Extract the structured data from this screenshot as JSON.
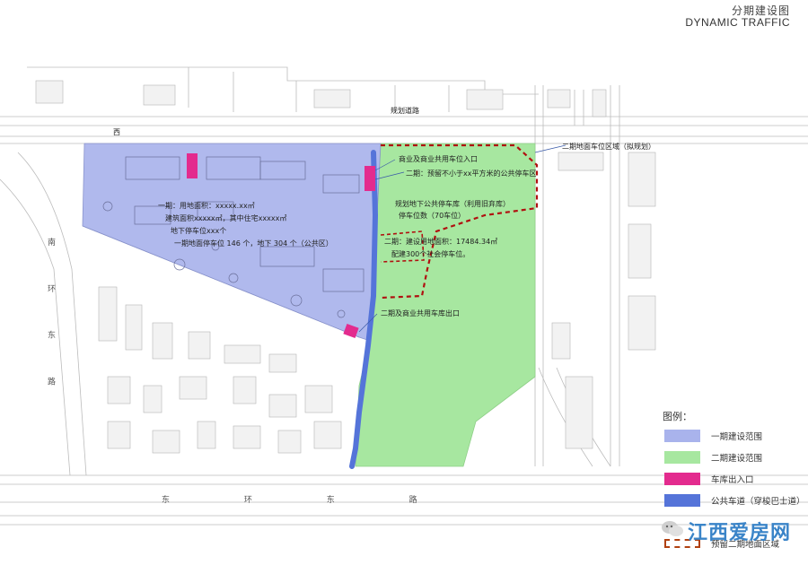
{
  "header": {
    "title_cn": "分期建设图",
    "title_en": "DYNAMIC TRAFFIC"
  },
  "annotations": {
    "phase1_entrance": "商业及商业共用车位入口",
    "phase2_entrance_top": "二期地面车位区域（拟规划）",
    "phase2_area_note": "二期：预留不小于xx平方米的公共停车区",
    "public_parking": "规划地下公共停车库（利用旧弃库）",
    "public_parking_count": "停车位数（70车位）",
    "phase2_building": "二期：建设用地面积：17484.34㎡",
    "phase2_building_2": "配建300个社会停车位。",
    "phase1_exit": "二期及商业共用车库出口",
    "phase1_detail_1": "一期：用地面积：xxxxx.xx㎡",
    "phase1_detail_2": "建筑面积xxxxx㎡，其中住宅xxxxx㎡",
    "phase1_detail_3": "地下停车位xxx个",
    "phase1_detail_4": "一期地面停车位 146 个，地下 304 个（公共区）",
    "road_top": "规划道路",
    "road_bottom": "东 环 东 路",
    "road_left": "南 环 东 路",
    "north_label": "西"
  },
  "legend": {
    "title": "图例：",
    "items": [
      {
        "label": "一期建设范围",
        "color": "#a9b3ec"
      },
      {
        "label": "二期建设范围",
        "color": "#a7e7a0"
      },
      {
        "label": "车库出入口",
        "color": "#e32b8e"
      },
      {
        "label": "公共车道（穿梭巴士道）",
        "color": "#5574d9"
      },
      {
        "label": "预留二期地面区域",
        "color": "#b04010"
      }
    ]
  },
  "watermark": {
    "text": "江西爱房网"
  },
  "colors": {
    "phase1": "#a9b3ec",
    "phase2": "#a7e7a0",
    "entrance": "#e32b8e",
    "road": "#5574d9",
    "dashed": "#b01010"
  }
}
